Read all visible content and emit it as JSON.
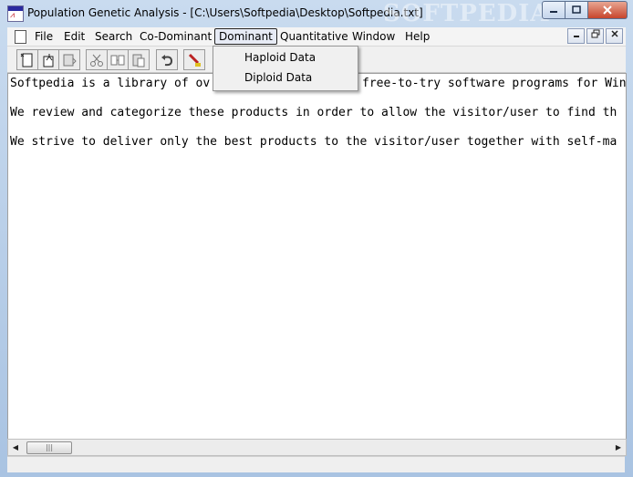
{
  "window": {
    "title": "Population Genetic Analysis - [C:\\Users\\Softpedia\\Desktop\\Softpedia.txt]",
    "watermark": "SOFTPEDIA"
  },
  "menubar": {
    "items": [
      "File",
      "Edit",
      "Search",
      "Co-Dominant",
      "Dominant",
      "Quantitative",
      "Window",
      "Help"
    ],
    "active": "Dominant"
  },
  "dropdown": {
    "items": [
      "Haploid Data",
      "Diploid Data"
    ]
  },
  "toolbar": {
    "icons": [
      "new-icon",
      "open-icon",
      "save-icon",
      "cut-icon",
      "copy-icon",
      "paste-icon",
      "undo-icon",
      "run-icon"
    ]
  },
  "document": {
    "lines": [
      "Softpedia is a library of ov",
      "We review and categorize these products in order to allow the visitor/user to find th",
      "We strive to deliver only the best products to the visitor/user together with self-ma"
    ],
    "line1_tail": "free-to-try software programs for Win"
  },
  "colors": {
    "titlebar": "#bcd0e8",
    "close_button": "#c7452c"
  }
}
